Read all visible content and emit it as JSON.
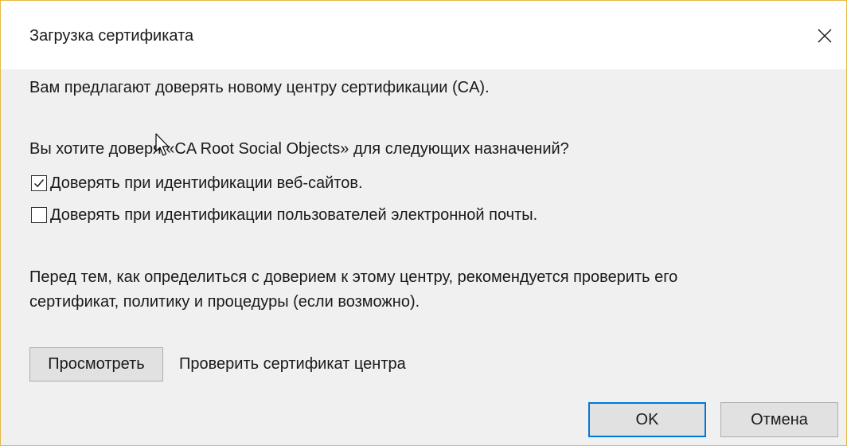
{
  "dialog": {
    "title": "Загрузка сертификата",
    "intro": "Вам предлагают доверять новому центру сертификации (CA).",
    "question_part1": "Вы хотите доверя",
    "question_part2": " «CA Root Social Objects» для следующих назначений?",
    "trust_options": [
      {
        "label": "Доверять при идентификации веб-сайтов.",
        "checked": true
      },
      {
        "label": "Доверять при идентификации пользователей электронной почты.",
        "checked": false
      }
    ],
    "advice_line1": "Перед тем, как определиться с доверием к этому центру, рекомендуется проверить его",
    "advice_line2": "сертификат, политику и процедуры (если возможно).",
    "view_button": "Просмотреть",
    "view_description": "Проверить сертификат центра",
    "ok_button": "OK",
    "cancel_button": "Отмена"
  },
  "icons": {
    "close": "close-icon",
    "cursor": "mouse-pointer-icon",
    "check": "checkmark-icon"
  },
  "colors": {
    "window_border": "#e6b845",
    "content_background": "#f0f0f0",
    "default_button_border": "#0078d7",
    "button_background": "#e1e1e1"
  }
}
